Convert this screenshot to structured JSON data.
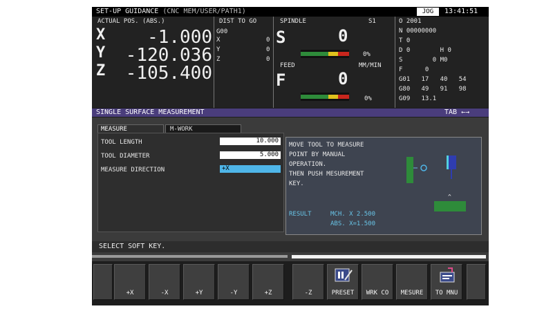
{
  "title": {
    "screen_name": "SET-UP GUIDANCE",
    "path": "(CNC MEM/USER/PATH1)",
    "mode": "JOG",
    "clock": "13:41:51"
  },
  "actual_pos": {
    "header_a": "ACTUAL POS.",
    "header_b": "(ABS.)",
    "axes": [
      {
        "label": "X",
        "value": "-1.000"
      },
      {
        "label": "Y",
        "value": "-120.036"
      },
      {
        "label": "Z",
        "value": "-105.400"
      }
    ]
  },
  "dist_to_go": {
    "header": "DIST TO GO",
    "code": "G00",
    "rows": [
      {
        "axis": "X",
        "value": "0"
      },
      {
        "axis": "Y",
        "value": "0"
      },
      {
        "axis": "Z",
        "value": "0"
      }
    ]
  },
  "spindle": {
    "header": "SPINDLE",
    "s_label": "S1",
    "S": "S",
    "s_value": "0",
    "pct": "0%",
    "feed_label": "FEED",
    "feed_unit": "MM/MIN",
    "F": "F",
    "f_value": "0",
    "pct2": "0%"
  },
  "program": {
    "lines": [
      "O 2001",
      "N 00000000",
      "T 0",
      "D 0        H 0",
      "S        0 M0",
      "F      0",
      "G01   17   40   54",
      "G80   49   91   98",
      "G09   13.1"
    ]
  },
  "band": {
    "title": "SINGLE SURFACE MEASUREMENT",
    "tab_hint": "TAB ←→"
  },
  "tabs": [
    {
      "label": "MEASURE"
    },
    {
      "label": "M-WORK"
    }
  ],
  "form": {
    "tool_length_label": "TOOL LENGTH",
    "tool_length_value": "10.000",
    "tool_diameter_label": "TOOL DIAMETER",
    "tool_diameter_value": "5.000",
    "measure_dir_label": "MEASURE DIRECTION",
    "measure_dir_value": "+X"
  },
  "guide": {
    "lines": [
      "MOVE TOOL TO MEASURE",
      "POINT BY MANUAL",
      "OPERATION.",
      "THEN PUSH MESUREMENT",
      "KEY."
    ],
    "result_label": "RESULT",
    "result_mch": "MCH. X 2.500",
    "result_abs": "ABS. X=1.500"
  },
  "prompt": "SELECT SOFT KEY.",
  "softkeys": [
    {
      "label": "+X"
    },
    {
      "label": "-X"
    },
    {
      "label": "+Y"
    },
    {
      "label": "-Y"
    },
    {
      "label": "+Z"
    },
    {
      "label": "-Z"
    },
    {
      "label": "PRESET"
    },
    {
      "label": "WRK CO"
    },
    {
      "label": "MESURE"
    },
    {
      "label": "TO MNU"
    }
  ],
  "colors": {
    "band": "#4a3d7c",
    "input_bg": "#ffffff",
    "select_bg": "#4fb6e8",
    "guide_text": "#e8e8e8",
    "result_text": "#68c3e6",
    "probe_green": "#2e8b3a",
    "probe_blue": "#2f3db0"
  }
}
